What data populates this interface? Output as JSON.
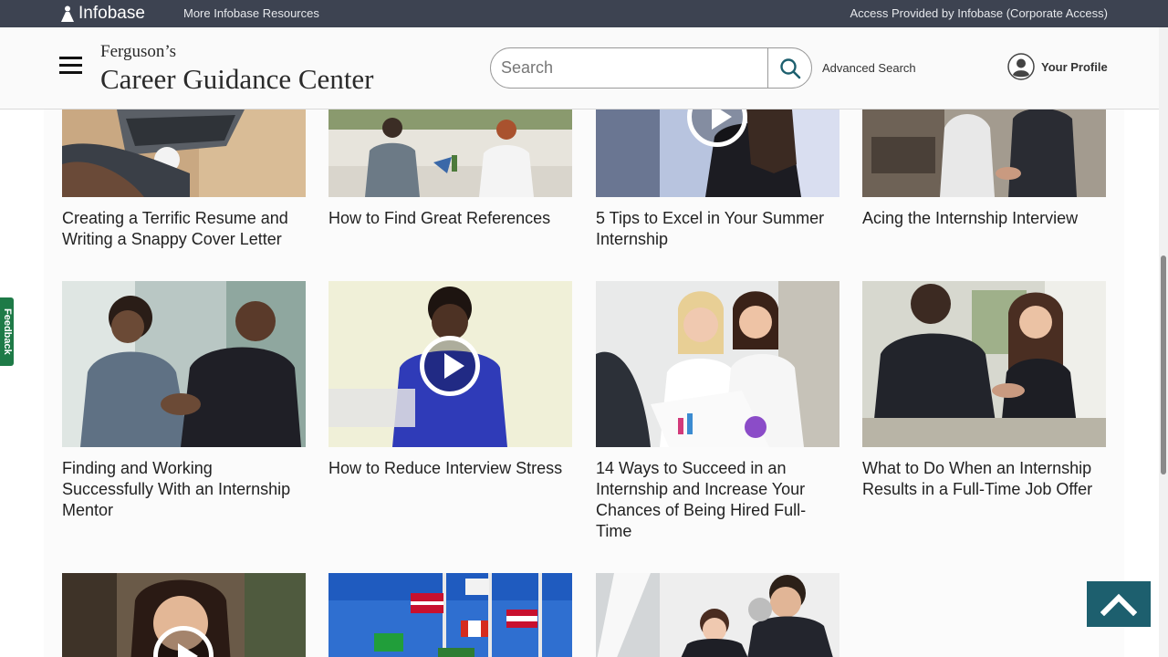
{
  "topbar": {
    "logo_text": "Infobase",
    "more_resources": "More Infobase Resources",
    "access": "Access Provided by Infobase (Corporate Access)"
  },
  "header": {
    "brand_line1": "Ferguson’s",
    "brand_line2": "Career Guidance Center",
    "search_placeholder": "Search",
    "advanced_search": "Advanced Search",
    "profile": "Your Profile"
  },
  "feedback": "Feedback",
  "cards": [
    {
      "title": "Creating a Terrific Resume and Writing a Snappy Cover Letter",
      "video": false
    },
    {
      "title": "How to Find Great References",
      "video": false
    },
    {
      "title": "5 Tips to Excel in Your Summer Internship",
      "video": true
    },
    {
      "title": "Acing the Internship Interview",
      "video": false
    },
    {
      "title": "Finding and Working Successfully With an Internship Mentor",
      "video": false
    },
    {
      "title": "How to Reduce Interview Stress",
      "video": true
    },
    {
      "title": "14 Ways to Succeed in an Internship and Increase Your Chances of Being Hired Full-Time",
      "video": false
    },
    {
      "title": "What to Do When an Internship Results in a Full-Time Job Offer",
      "video": false
    },
    {
      "title": "",
      "video": true
    },
    {
      "title": "",
      "video": false
    },
    {
      "title": "",
      "video": false
    }
  ],
  "colors": {
    "topbar": "#3d4351",
    "feedback": "#1e7a47",
    "back_to_top": "#1d5f6e"
  }
}
